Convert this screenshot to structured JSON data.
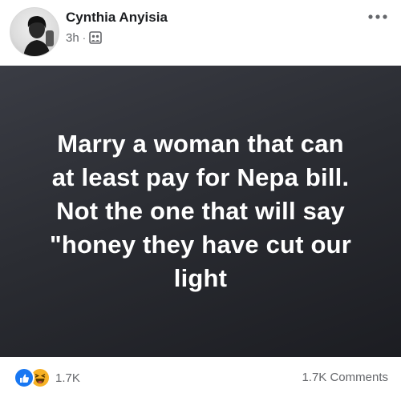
{
  "post": {
    "author": "Cynthia Anyisia",
    "timestamp": "3h",
    "separator": "·",
    "privacy_icon": "group-privacy-icon",
    "text_lines": [
      "Marry a woman that can",
      "at least pay for Nepa bill.",
      "Not the one that will say",
      "\"honey they have cut our",
      "light"
    ]
  },
  "footer": {
    "reactions": [
      "like-icon",
      "haha-icon"
    ],
    "reaction_count": "1.7K",
    "comments_label": "1.7K Comments"
  },
  "colors": {
    "like": "#1877f2",
    "haha": "#f7b125",
    "post_bg": "#2b2d33",
    "text_muted": "#65676b"
  }
}
